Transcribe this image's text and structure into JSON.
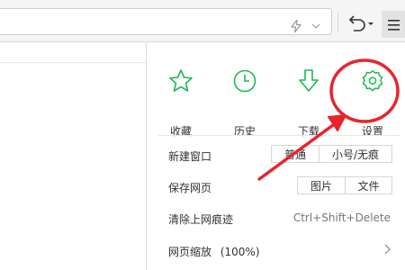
{
  "toolbar": {
    "address_value": "",
    "icons": [
      "bolt-icon",
      "chevron-down-icon",
      "undo-icon",
      "hamburger-menu-icon"
    ]
  },
  "menu": {
    "tiles": [
      {
        "label": "收藏",
        "icon": "star-icon"
      },
      {
        "label": "历史",
        "icon": "clock-icon"
      },
      {
        "label": "下载",
        "icon": "download-icon"
      },
      {
        "label": "设置",
        "icon": "gear-icon"
      }
    ],
    "new_window": {
      "label": "新建窗口",
      "normal": "普通",
      "incognito": "小号/无痕"
    },
    "save_page": {
      "label": "保存网页",
      "image": "图片",
      "file": "文件"
    },
    "clear_history": {
      "label": "清除上网痕迹",
      "shortcut": "Ctrl+Shift+Delete"
    },
    "zoom": {
      "label": "网页缩放",
      "value": "(100%)"
    }
  },
  "colors": {
    "accent_green": "#1db954",
    "highlight_red": "#e8242b"
  }
}
